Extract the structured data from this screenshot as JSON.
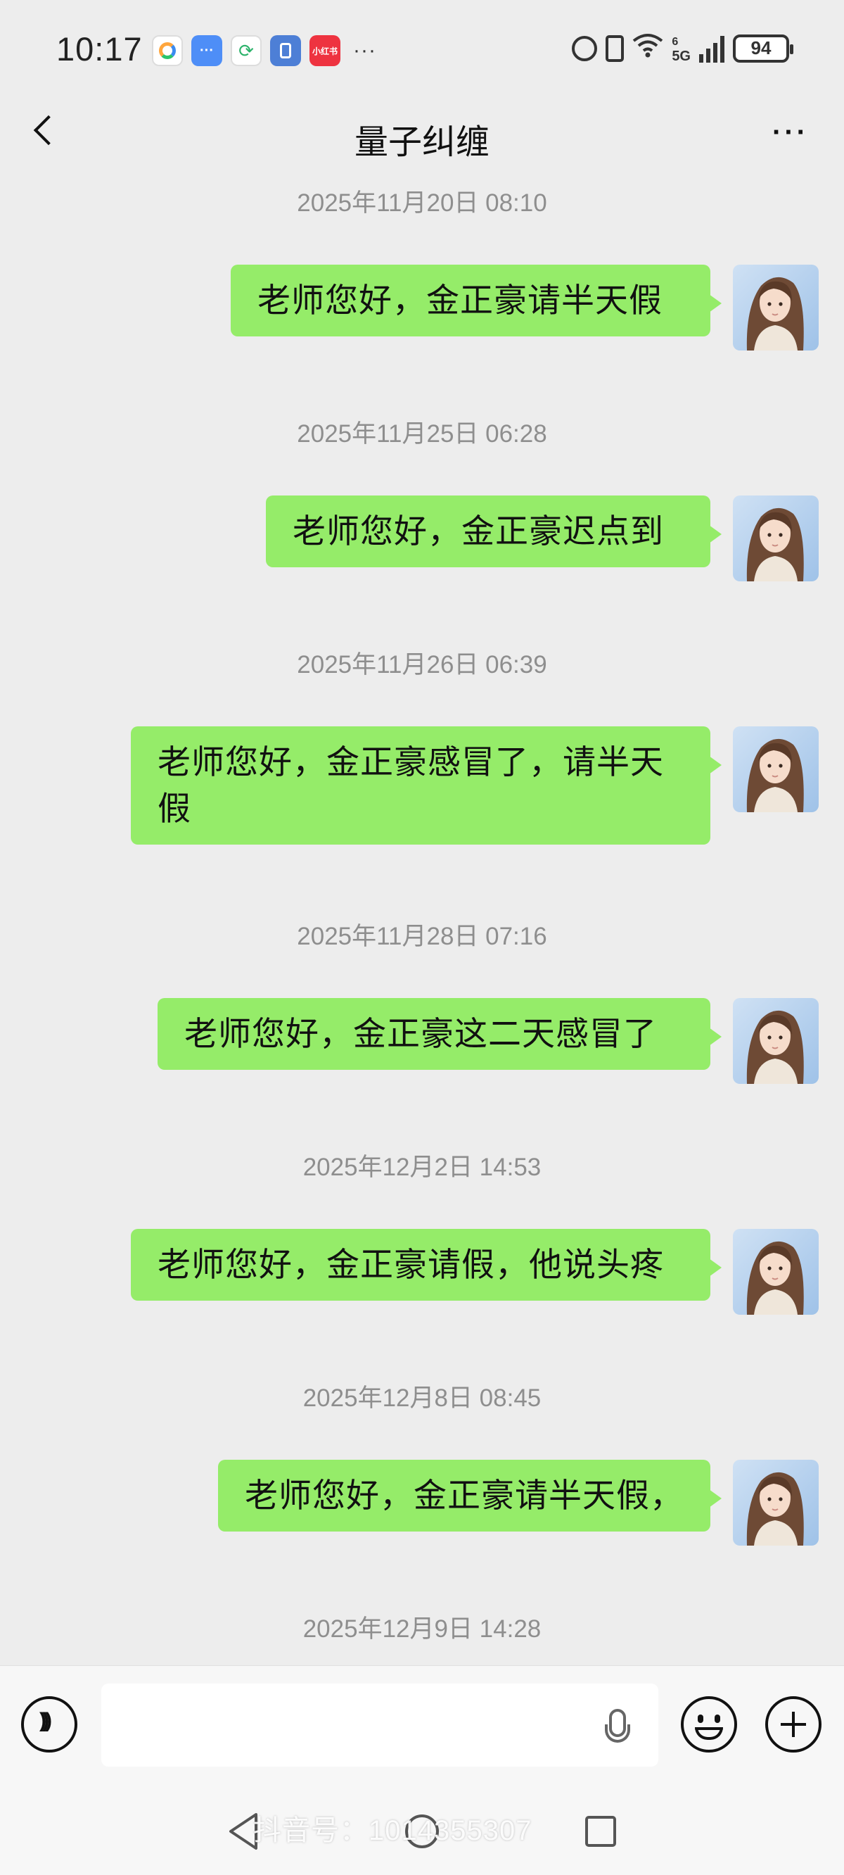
{
  "status_bar": {
    "time": "10:17",
    "notification_icons": [
      "app-icon-1",
      "message-icon",
      "chat-icon",
      "app-icon-4",
      "xiaohongshu-icon"
    ],
    "xiaohongshu_label": "小红书",
    "more": "···",
    "network": "5G",
    "signal_slot": "6",
    "battery": "94"
  },
  "header": {
    "title": "量子纠缠",
    "more": "···"
  },
  "messages": [
    {
      "time": "2025年11月20日 08:10",
      "text": "老师您好，金正豪请半天假"
    },
    {
      "time": "2025年11月25日 06:28",
      "text": "老师您好，金正豪迟点到"
    },
    {
      "time": "2025年11月26日 06:39",
      "text": "老师您好，金正豪感冒了，请半天假"
    },
    {
      "time": "2025年11月28日 07:16",
      "text": "老师您好，金正豪这二天感冒了"
    },
    {
      "time": "2025年12月2日 14:53",
      "text": "老师您好，金正豪请假，他说头疼"
    },
    {
      "time": "2025年12月8日 08:45",
      "text": "老师您好，金正豪请半天假，"
    }
  ],
  "last_timestamp": "2025年12月9日 14:28",
  "input": {
    "value": "",
    "placeholder": ""
  },
  "watermark": "抖音号：1014355307"
}
